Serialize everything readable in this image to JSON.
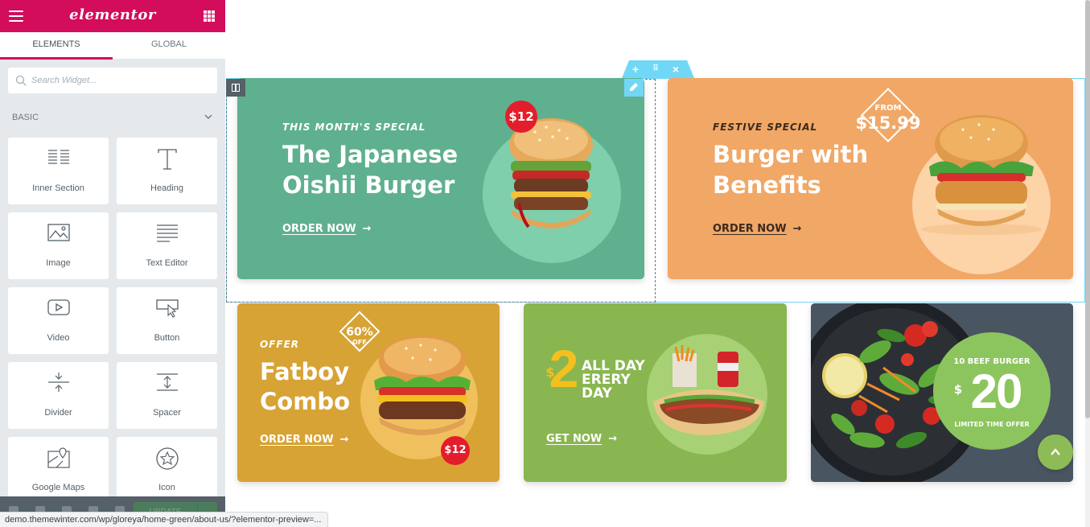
{
  "panel": {
    "logo": "elementor",
    "tabs": [
      "ELEMENTS",
      "GLOBAL"
    ],
    "search_placeholder": "Search Widget...",
    "category": "BASIC",
    "widgets": [
      "Inner Section",
      "Heading",
      "Image",
      "Text Editor",
      "Video",
      "Button",
      "Divider",
      "Spacer",
      "Google Maps",
      "Icon"
    ],
    "update_label": "UPDATE"
  },
  "status_url": "demo.themewinter.com/wp/gloreya/home-green/about-us/?elementor-preview=...",
  "banners": {
    "japanese": {
      "kicker": "THIS MONTH'S SPECIAL",
      "title_line1": "The Japanese",
      "title_line2": "Oishii Burger",
      "cta": "ORDER NOW",
      "price": "$12"
    },
    "festive": {
      "kicker": "FESTIVE SPECIAL",
      "title_line1": "Burger with",
      "title_line2": "Benefits",
      "cta": "ORDER NOW",
      "price_from": "FROM",
      "price": "$15.99"
    },
    "fatboy": {
      "kicker": "OFFER",
      "title_line1": "Fatboy",
      "title_line2": "Combo",
      "cta": "ORDER NOW",
      "discount": "60%",
      "discount_off": "OFF",
      "price": "$12"
    },
    "allday": {
      "dollar": "$",
      "number": "2",
      "line1": "ALL DAY",
      "line2": "ERERY",
      "line3": "DAY",
      "cta": "GET NOW"
    },
    "beef": {
      "top": "10 BEEF BURGER",
      "dollar": "$",
      "number": "20",
      "bottom": "LIMITED TIME OFFER"
    }
  },
  "colors": {
    "brand": "#d30c5c",
    "selection": "#71d7f7",
    "green": "#5fb08f",
    "orange": "#f1a766",
    "mustard": "#d7a335",
    "lime": "#89b650",
    "badge_red": "#e31d2b"
  }
}
